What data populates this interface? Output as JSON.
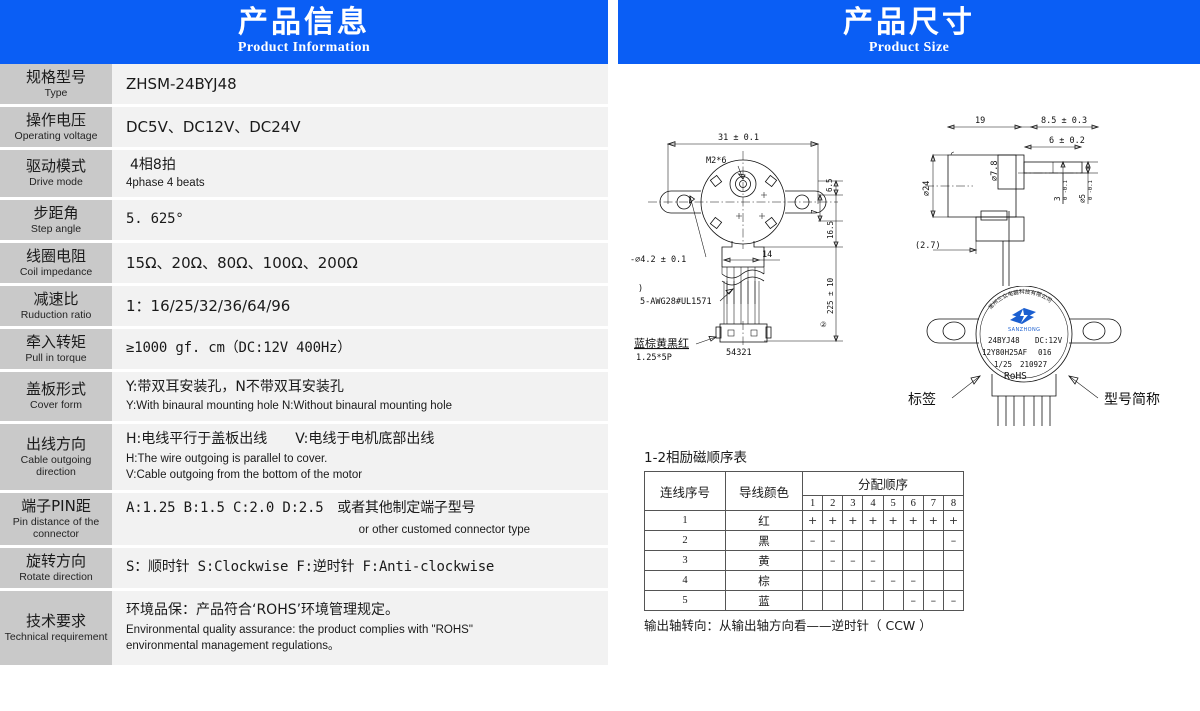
{
  "left": {
    "banner": {
      "cn": "产品信息",
      "en": "Product Information"
    },
    "rows": [
      {
        "label_cn": "规格型号",
        "label_en": "Type",
        "value_cn": "ZHSM-24BYJ48",
        "value_en": ""
      },
      {
        "label_cn": "操作电压",
        "label_en": "Operating voltage",
        "value_cn": "DC5V、DC12V、DC24V",
        "value_en": ""
      },
      {
        "label_cn": "驱动模式",
        "label_en": "Drive mode",
        "value_cn": "4相8拍",
        "value_en": "4phase 4 beats"
      },
      {
        "label_cn": "步距角",
        "label_en": "Step angle",
        "value_cn": "5. 625°",
        "value_en": ""
      },
      {
        "label_cn": "线圈电阻",
        "label_en": "Coil impedance",
        "value_cn": "15Ω、20Ω、80Ω、100Ω、200Ω",
        "value_en": ""
      },
      {
        "label_cn": "减速比",
        "label_en": "Ruduction ratio",
        "value_cn": "1：16/25/32/36/64/96",
        "value_en": ""
      },
      {
        "label_cn": "牵入转矩",
        "label_en": "Pull in torque",
        "value_cn": "≥1000 gf. cm（DC:12V 400Hz）",
        "value_en": ""
      },
      {
        "label_cn": "盖板形式",
        "label_en": "Cover form",
        "value_cn": "Y:带双耳安装孔，N不带双耳安装孔",
        "value_en": "Y:With binaural  mounting hole  N:Without binaural  mounting hole"
      },
      {
        "label_cn": "出线方向",
        "label_en": "Cable outgoing direction",
        "value_cn": "H:电线平行于盖板出线　　V:电线于电机底部出线",
        "value_en": "H:The wire outgoing is parallel to cover.",
        "value_en2": "V:Cable outgoing from the bottom of the motor"
      },
      {
        "label_cn": "端子PIN距",
        "label_en": "Pin  distance of the connector",
        "value_cn": "A:1.25 B:1.5 C:2.0 D:2.5　或者其他制定端子型号",
        "value_en": "or other customed  connector type"
      },
      {
        "label_cn": "旋转方向",
        "label_en": "Rotate direction",
        "value_cn": "S：顺时针 S:Clockwise F:逆时针 F:Anti-clockwise",
        "value_en": ""
      },
      {
        "label_cn": "技术要求",
        "label_en": "Technical requirement",
        "value_cn": "环境品保：产品符合‘ROHS’环境管理规定。",
        "value_en": "Environmental quality assurance: the product complies with \"ROHS\"",
        "value_en2": "environmental management regulations。"
      }
    ]
  },
  "right": {
    "banner": {
      "cn": "产品尺寸",
      "en": "Product Size"
    },
    "front_view": {
      "dim_width": "31 ± 0.1",
      "screw": "M2*6",
      "hole": "-⌀4.2 ± 0.1",
      "dim_6_5": "6.5",
      "dim_7": "7",
      "dim_16_5": "16.5",
      "dim_14": "14",
      "dim_cable_len": "225 ± 10",
      "qty_mark": "②",
      "wire_spec": "5-AWG28#UL1571",
      "wire_colors": "蓝棕黄黑红",
      "connector": "1.25*5P",
      "pin_numbers": "54321"
    },
    "side_view": {
      "dim_19": "19",
      "dim_8_5": "8.5 ± 0.3",
      "dim_6": "6 ± 0.2",
      "dim_d7_8": "⌀7.8",
      "dim_d24": "⌀24",
      "dim_3": "3",
      "dim_3_tol": "0 -0.1",
      "dim_d5": "⌀5",
      "dim_d5_tol": "0 -0.1",
      "dim_2_7": "(2.7)"
    },
    "label_view": {
      "brand_cn": "常州三众电器科技有限公司",
      "brand_en": "SANZHONG",
      "line1_model": "24BYJ48",
      "line1_volt": "DC:12V",
      "line2_code": "12Y80H25AF",
      "line2_num": "016",
      "line3_ratio": "1/25",
      "line3_date": "210927",
      "line4": "RoHS",
      "callout_left": "标签",
      "callout_right": "型号简称"
    },
    "seq_table": {
      "title": "1-2相励磁顺序表",
      "col_index": "连线序号",
      "col_color": "导线颜色",
      "col_group": "分配顺序",
      "steps": [
        "1",
        "2",
        "3",
        "4",
        "5",
        "6",
        "7",
        "8"
      ],
      "rows": [
        {
          "idx": "1",
          "color": "红",
          "signs": [
            "+",
            "+",
            "+",
            "+",
            "+",
            "+",
            "+",
            "+"
          ]
        },
        {
          "idx": "2",
          "color": "黑",
          "signs": [
            "–",
            "–",
            "",
            "",
            "",
            "",
            "",
            "–"
          ]
        },
        {
          "idx": "3",
          "color": "黄",
          "signs": [
            "",
            "–",
            "–",
            "–",
            "",
            "",
            "",
            ""
          ]
        },
        {
          "idx": "4",
          "color": "棕",
          "signs": [
            "",
            "",
            "",
            "–",
            "–",
            "–",
            "",
            ""
          ]
        },
        {
          "idx": "5",
          "color": "蓝",
          "signs": [
            "",
            "",
            "",
            "",
            "",
            "–",
            "–",
            "–"
          ]
        }
      ],
      "note": "输出轴转向：从输出轴方向看——逆时针（ CCW ）"
    }
  },
  "colors": {
    "brand_blue": "#0a5ef5",
    "label_bg": "#c9c9c9",
    "value_bg": "#f2f2f2"
  }
}
